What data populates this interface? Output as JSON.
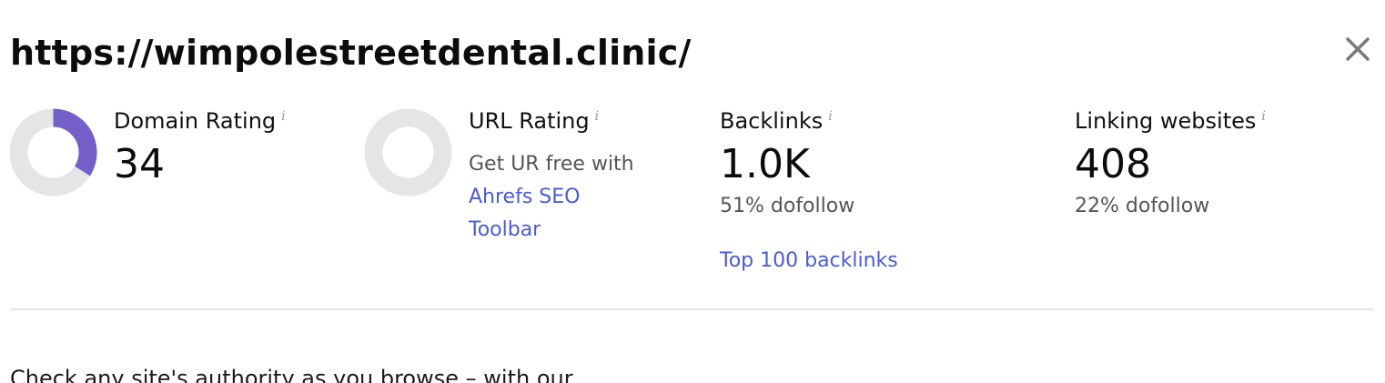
{
  "header": {
    "url": "https://wimpolestreetdental.clinic/",
    "close_icon": "close-icon"
  },
  "metrics": {
    "domain_rating": {
      "label": "Domain Rating",
      "info": "i",
      "value": "34",
      "gauge_fraction": 0.34,
      "color": "#7460c8",
      "track_color": "#e5e5e5"
    },
    "url_rating": {
      "label": "URL Rating",
      "info": "i",
      "cta_text": "Get UR free with",
      "link_line1": "Ahrefs SEO",
      "link_line2": "Toolbar",
      "track_color": "#e5e5e5"
    },
    "backlinks": {
      "label": "Backlinks",
      "info": "i",
      "value": "1.0K",
      "dofollow": "51% dofollow",
      "link": "Top 100 backlinks"
    },
    "linking_websites": {
      "label": "Linking websites",
      "info": "i",
      "value": "408",
      "dofollow": "22% dofollow"
    }
  },
  "footer": {
    "text": "Check any site's authority as you browse – with our"
  },
  "colors": {
    "link": "#4a5bd6",
    "accent": "#7460c8"
  }
}
